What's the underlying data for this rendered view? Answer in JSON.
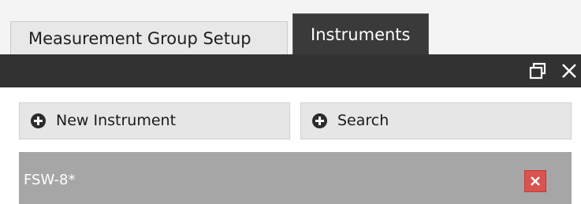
{
  "tabs": [
    {
      "label": "Measurement Group Setup",
      "active": false
    },
    {
      "label": "Instruments",
      "active": true
    }
  ],
  "titlebar": {
    "icons": [
      "restore-window-icon",
      "close-icon"
    ]
  },
  "actions": {
    "new_instrument": {
      "label": "New Instrument",
      "icon": "plus-circle-icon"
    },
    "search": {
      "label": "Search",
      "icon": "plus-circle-icon"
    }
  },
  "instruments": [
    {
      "name": "FSW-8*",
      "remove_icon": "close-icon"
    }
  ],
  "colors": {
    "active_tab": "#3a3a3a",
    "titlebar": "#323232",
    "row_bg": "#a6a6a6",
    "remove_button": "#d9534f"
  }
}
